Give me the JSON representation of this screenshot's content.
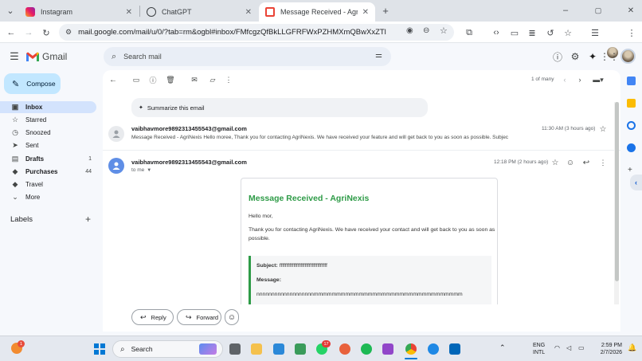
{
  "browser": {
    "tabs": [
      {
        "title": "Instagram",
        "close": "✕"
      },
      {
        "title": "ChatGPT",
        "close": "✕"
      },
      {
        "title": "Message Received - AgriNexis",
        "close": "✕"
      }
    ],
    "new_tab": "+",
    "url": "mail.google.com/mail/u/0/?tab=rm&ogbl#inbox/FMfcgzQfBkLLGFRFWxPZHMXmQBwXxZTl",
    "window_controls": {
      "minimize": "–",
      "maximize": "▢",
      "close": "✕"
    }
  },
  "gmail": {
    "logo_text": "Gmail",
    "search_placeholder": "Search mail",
    "compose_label": "Compose"
  },
  "sidebar": {
    "items": [
      {
        "label": "Inbox",
        "count": "",
        "icon": "inbox-icon"
      },
      {
        "label": "Starred",
        "count": "",
        "icon": "star-icon"
      },
      {
        "label": "Snoozed",
        "count": "",
        "icon": "clock-icon"
      },
      {
        "label": "Sent",
        "count": "",
        "icon": "send-icon"
      },
      {
        "label": "Drafts",
        "count": "1",
        "icon": "draft-icon"
      },
      {
        "label": "Purchases",
        "count": "44",
        "icon": "tag-icon"
      },
      {
        "label": "Travel",
        "count": "",
        "icon": "tag-icon"
      },
      {
        "label": "More",
        "count": "",
        "icon": "chevron-down-icon"
      }
    ],
    "labels_heading": "Labels",
    "labels_add": "+"
  },
  "toolbar": {
    "pagination": "1 of many"
  },
  "summarize_label": "Summarize this email",
  "messages": [
    {
      "sender": "vaibhavmore98923134​55543@gmail.com",
      "time": "11:30 AM (3 hours ago)",
      "snippet": "Message Received - AgriNexis Hello moree, Thank you for contacting AgriNexis. We have received your feature and will get back to you as soon as possible. Subjec"
    },
    {
      "sender": "vaibhavmore9892313455543@gmail.com",
      "time": "12:18 PM (2 hours ago)",
      "to": "to me"
    }
  ],
  "email_body": {
    "title": "Message Received - AgriNexis",
    "greeting": "Hello mor,",
    "paragraph_line1": "Thank you for contacting AgriNexis. We have received your contact and will get back to you as soon as",
    "paragraph_line2": "possible.",
    "subject_label": "Subject:",
    "subject_value": "ffffffffffffffffffffffffffffffffff",
    "message_label": "Message:",
    "message_value": "nnnnnnnnnnnnnnnnnnnmmmmmmmmmmmmmmmmmmmmmmmmmmmmmmmmm"
  },
  "actions": {
    "reply": "Reply",
    "forward": "Forward"
  },
  "taskbar": {
    "search_label": "Search",
    "whatsapp_badge": "17",
    "weather_badge": "1",
    "lang_line1": "ENG",
    "lang_line2": "INTL",
    "time": "2:59 PM",
    "date": "2/7/2026"
  }
}
